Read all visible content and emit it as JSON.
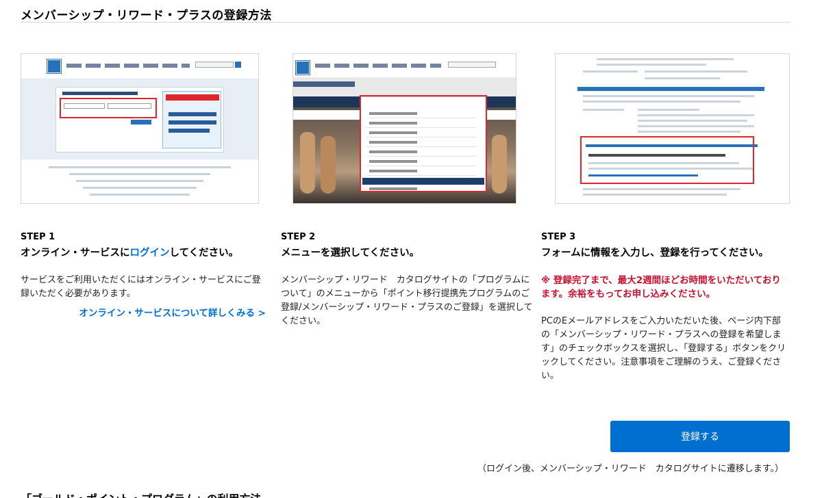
{
  "page": {
    "title": "メンバーシップ・リワード・プラスの登録方法"
  },
  "steps": [
    {
      "number": "STEP 1",
      "heading_before": "オンライン・サービスに",
      "heading_link": "ログイン",
      "heading_after": "してください。",
      "body": "サービスをご利用いただくにはオンライン・サービスにご登録いただく必要があります。",
      "link": "オンライン・サービスについて詳しくみる >"
    },
    {
      "number": "STEP 2",
      "heading": "メニューを選択してください。",
      "body": "メンバーシップ・リワード　カタログサイトの「プログラムについて」のメニューから「ポイント移行提携先プログラムのご登録/メンバーシップ・リワード・プラスのご登録」を選択してください。"
    },
    {
      "number": "STEP 3",
      "heading": "フォームに情報を入力し、登録を行ってください。",
      "warning": "※ 登録完了まで、最大2週間ほどお時間をいただいております。余裕をもってお申し込みください。",
      "body": "PCのEメールアドレスをご入力いただいた後、ページ内下部の「メンバーシップ・リワード・プラスへの登録を希望します」のチェックボックスを選択し、「登録する」ボタンをクリックしてください。注意事項をご理解のうえ、ご登録ください。"
    }
  ],
  "register_button": "登録する",
  "note": "（ログイン後、メンバーシップ・リワード　カタログサイトに遷移します。）",
  "next_section_heading": "「ゴールド・ポイント・プログラム」の利用方法",
  "colors": {
    "accent": "#006fcf",
    "warning": "#c8102e",
    "highlight_box": "#e0262d"
  }
}
